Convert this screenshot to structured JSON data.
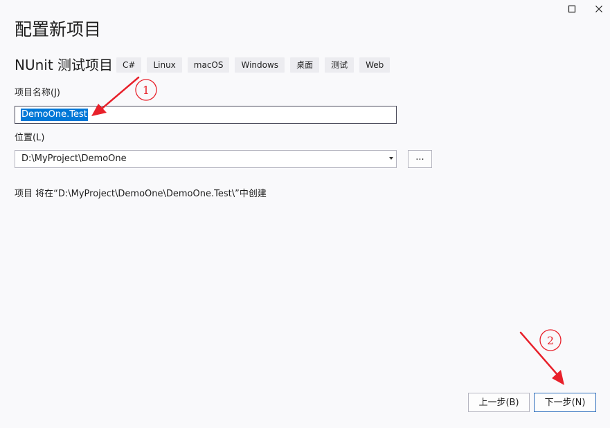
{
  "window": {
    "maximize_icon": "maximize-icon",
    "close_icon": "close-icon"
  },
  "page": {
    "title": "配置新项目",
    "template_name": "NUnit 测试项目",
    "tags": [
      "C#",
      "Linux",
      "macOS",
      "Windows",
      "桌面",
      "测试",
      "Web"
    ]
  },
  "form": {
    "project_name_label": "项目名称(J)",
    "project_name_value": "DemoOne.Test",
    "location_label": "位置(L)",
    "location_value": "D:\\MyProject\\DemoOne",
    "browse_label": "...",
    "info_text": "项目 将在“D:\\MyProject\\DemoOne\\DemoOne.Test\\”中创建"
  },
  "footer": {
    "prev_label": "上一步(B)",
    "next_label": "下一步(N)"
  },
  "annotations": {
    "marker_1": "1",
    "marker_2": "2",
    "color": "#e8202a"
  }
}
